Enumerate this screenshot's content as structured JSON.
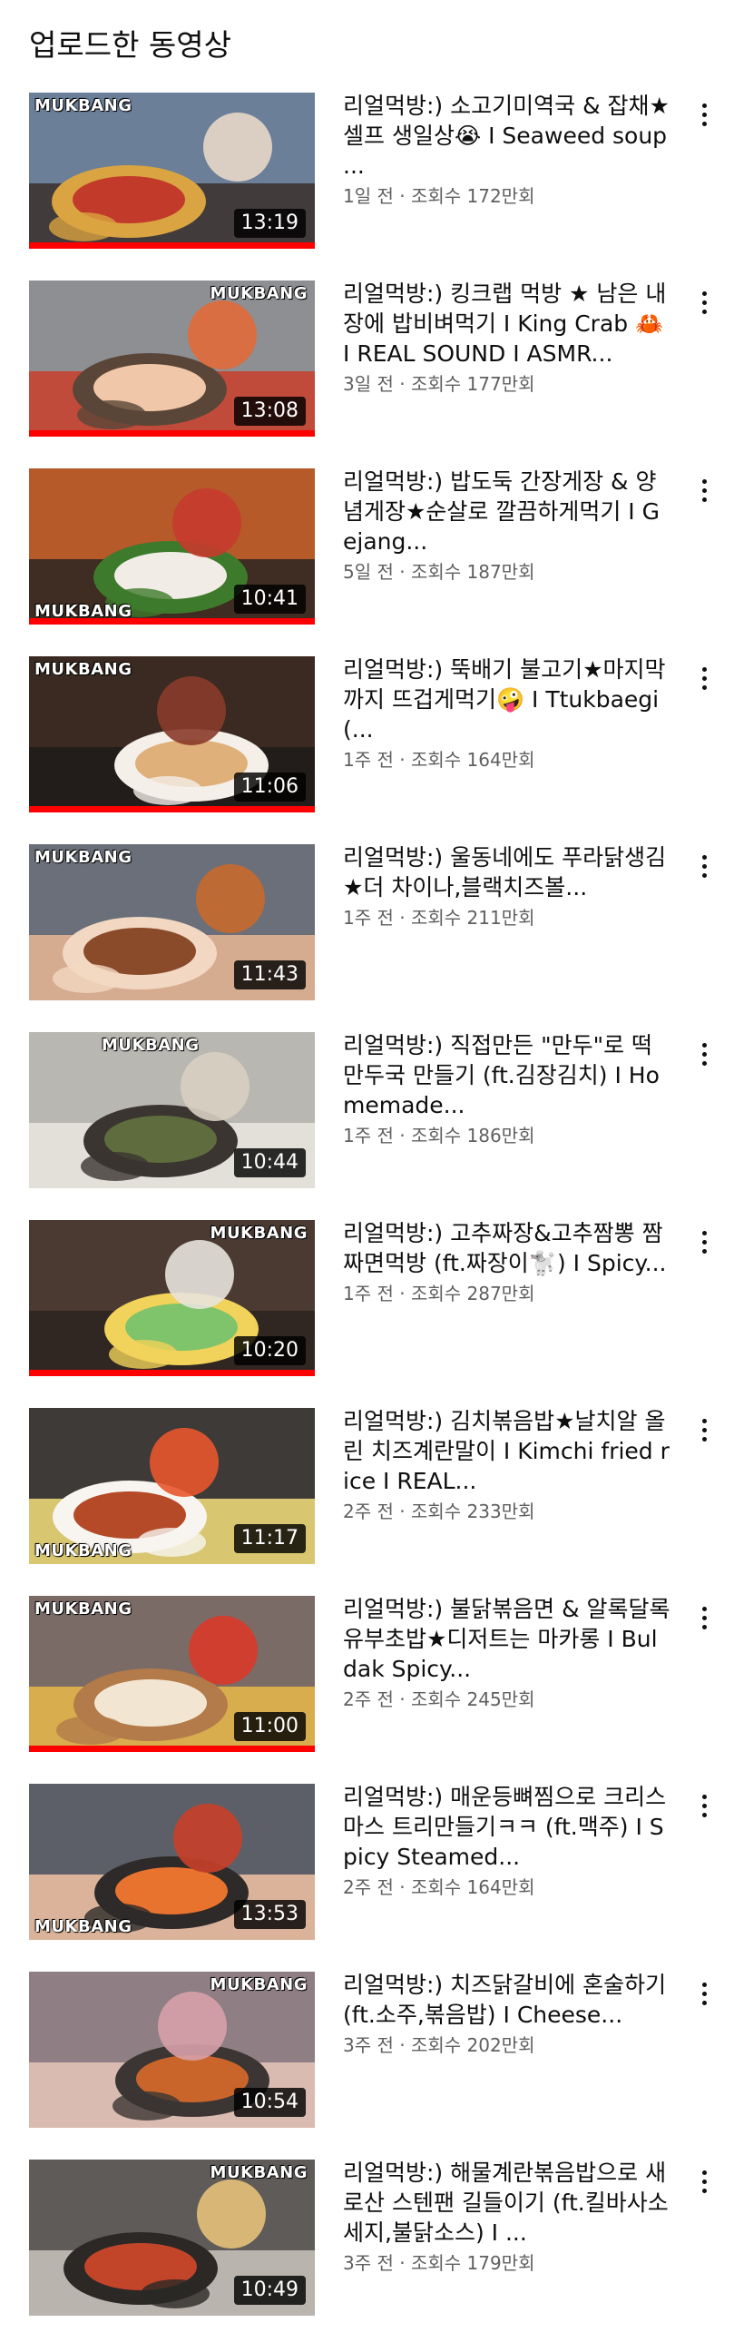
{
  "section": {
    "title": "업로드한 동영상"
  },
  "videos": [
    {
      "title": "리얼먹방:) 소고기미역국 & 잡채★셀프 생일상😭 I Seaweed soup ...",
      "meta": "1일 전 · 조회수 172만회",
      "duration": "13:19",
      "badge": "MUKBANG",
      "badge_pos": "top-left",
      "progress": 1.0
    },
    {
      "title": "리얼먹방:) 킹크랩 먹방 ★ 남은 내장에 밥비벼먹기 I King Crab 🦀 I REAL SOUND I ASMR...",
      "meta": "3일 전 · 조회수 177만회",
      "duration": "13:08",
      "badge": "MUKBANG",
      "badge_pos": "top-right",
      "progress": 1.0
    },
    {
      "title": "리얼먹방:) 밥도둑 간장게장 & 양념게장★순살로 깔끔하게먹기 I Gejang...",
      "meta": "5일 전 · 조회수 187만회",
      "duration": "10:41",
      "badge": "MUKBANG",
      "badge_pos": "bottom-left",
      "progress": 1.0
    },
    {
      "title": "리얼먹방:) 뚝배기 불고기★마지막까지 뜨겁게먹기🤪 I Ttukbaegi(...",
      "meta": "1주 전 · 조회수 164만회",
      "duration": "11:06",
      "badge": "MUKBANG",
      "badge_pos": "top-left",
      "progress": 1.0
    },
    {
      "title": "리얼먹방:) 울동네에도 푸라닭생김★더 차이나,블랙치즈볼...",
      "meta": "1주 전 · 조회수 211만회",
      "duration": "11:43",
      "badge": "MUKBANG",
      "badge_pos": "top-left",
      "progress": 0.0
    },
    {
      "title": "리얼먹방:) 직접만든 \"만두\"로 떡만두국 만들기 (ft.김장김치) I Homemade...",
      "meta": "1주 전 · 조회수 186만회",
      "duration": "10:44",
      "badge": "MUKBANG",
      "badge_pos": "top-center",
      "progress": 0.0
    },
    {
      "title": "리얼먹방:) 고추짜장&고추짬뽕 짬짜면먹방 (ft.짜장이🐩) I Spicy...",
      "meta": "1주 전 · 조회수 287만회",
      "duration": "10:20",
      "badge": "MUKBANG",
      "badge_pos": "top-right",
      "progress": 1.0
    },
    {
      "title": "리얼먹방:) 김치볶음밥★날치알 올린 치즈계란말이 I Kimchi fried rice I REAL...",
      "meta": "2주 전 · 조회수 233만회",
      "duration": "11:17",
      "badge": "MUKBANG",
      "badge_pos": "bottom-left",
      "progress": 0.0
    },
    {
      "title": "리얼먹방:) 불닭볶음면 & 알록달록 유부초밥★디저트는 마카롱 I Buldak Spicy...",
      "meta": "2주 전 · 조회수 245만회",
      "duration": "11:00",
      "badge": "MUKBANG",
      "badge_pos": "top-left",
      "progress": 1.0
    },
    {
      "title": "리얼먹방:) 매운등뼈찜으로 크리스마스 트리만들기ㅋㅋ (ft.맥주) I Spicy Steamed...",
      "meta": "2주 전 · 조회수 164만회",
      "duration": "13:53",
      "badge": "MUKBANG",
      "badge_pos": "bottom-left",
      "progress": 0.0
    },
    {
      "title": "리얼먹방:) 치즈닭갈비에 혼술하기 (ft.소주,볶음밥) I Cheese...",
      "meta": "3주 전 · 조회수 202만회",
      "duration": "10:54",
      "badge": "MUKBANG",
      "badge_pos": "top-right",
      "progress": 0.0
    },
    {
      "title": "리얼먹방:) 해물계란볶음밥으로 새로산 스텐팬 길들이기 (ft.킬바사소세지,불닭소스) I ...",
      "meta": "3주 전 · 조회수 179만회",
      "duration": "10:49",
      "badge": "MUKBANG",
      "badge_pos": "top-right",
      "progress": 0.0
    }
  ],
  "colors": {
    "progress_red": "#ff0000",
    "meta_gray": "#606060",
    "duration_bg": "#000000"
  },
  "icons": {
    "more": "more-vert-icon"
  }
}
